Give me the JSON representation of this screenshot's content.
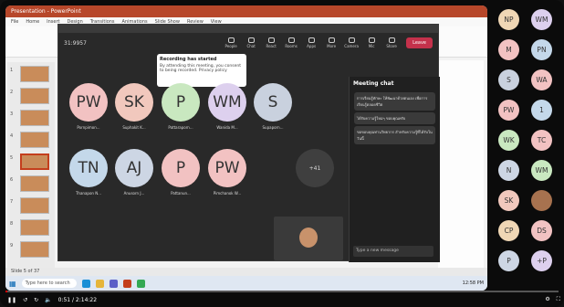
{
  "teams": {
    "timer": "31:9957",
    "tools": [
      "People",
      "Chat",
      "React",
      "Rooms",
      "Apps",
      "More",
      "Camera",
      "Mic",
      "Share"
    ],
    "leave_label": "Leave",
    "tooltip_title": "Recording has started",
    "tooltip_body": "By attending this meeting, you consent to being recorded. Privacy policy"
  },
  "tiles": [
    {
      "initials": "PW",
      "color": "#f2c2c2",
      "name": "Pornpimon..."
    },
    {
      "initials": "SK",
      "color": "#f1c8bd",
      "name": "Suphakit K..."
    },
    {
      "initials": "P",
      "color": "#c9e8c0",
      "name": "Pattaraporn..."
    },
    {
      "initials": "WM",
      "color": "#ddd0ee",
      "name": "Wanida M..."
    },
    {
      "initials": "S",
      "color": "#c9d1de",
      "name": "Supaporn..."
    },
    {
      "initials": "TN",
      "color": "#c4d8ea",
      "name": "Thanapon N..."
    },
    {
      "initials": "AJ",
      "color": "#cdd6e4",
      "name": "Anusorn J..."
    },
    {
      "initials": "P",
      "color": "#f2c2c2",
      "name": "Pattanun..."
    },
    {
      "initials": "PW",
      "color": "#f2c2c2",
      "name": "Pimchanok W..."
    }
  ],
  "more_label": "+41",
  "chat": {
    "title": "Meeting chat",
    "messages": [
      "การเรียนรู้ทักษะ ให้พัฒนาด้วยตนเอง เพื่อการเรียนรู้ตลอดชีวิต",
      "ได้รับความรู้ใหม่ๆ ขอบคุณครับ",
      "ขอขอบคุณท่านวิทยากร สำหรับความรู้ที่ได้รับในวันนี้"
    ],
    "compose_placeholder": "Type a new message"
  },
  "strip": [
    {
      "initials": "NP",
      "color": "#f0d7b5"
    },
    {
      "initials": "WM",
      "color": "#ddd0ee"
    },
    {
      "initials": "M",
      "color": "#f2c2c2"
    },
    {
      "initials": "PN",
      "color": "#c4d8ea"
    },
    {
      "initials": "S",
      "color": "#c9d1de"
    },
    {
      "initials": "WA",
      "color": "#f2c2c2"
    },
    {
      "initials": "PW",
      "color": "#f2c2c2"
    },
    {
      "initials": "1",
      "color": "#c4d8ea"
    },
    {
      "initials": "WK",
      "color": "#c9e8c0"
    },
    {
      "initials": "TC",
      "color": "#f2c2c2"
    },
    {
      "initials": "N",
      "color": "#cdd6e4"
    },
    {
      "initials": "WM",
      "color": "#c9e8c0"
    },
    {
      "initials": "SK",
      "color": "#f1c8bd"
    },
    {
      "initials": "",
      "color": "#a7724f"
    },
    {
      "initials": "CP",
      "color": "#f0d7b5"
    },
    {
      "initials": "DS",
      "color": "#f2c2c2"
    },
    {
      "initials": "P",
      "color": "#cdd6e4"
    },
    {
      "initials": "+P",
      "color": "#ddd0ee"
    }
  ],
  "ppt": {
    "title": "Presentation - PowerPoint",
    "tabs": [
      "File",
      "Home",
      "Insert",
      "Design",
      "Transitions",
      "Animations",
      "Slide Show",
      "Review",
      "View"
    ],
    "status": "Slide 5 of 37",
    "taskbar_search": "Type here to search",
    "clock": "12:58 PM"
  },
  "player": {
    "time": "0:51 / 2:14:22"
  }
}
